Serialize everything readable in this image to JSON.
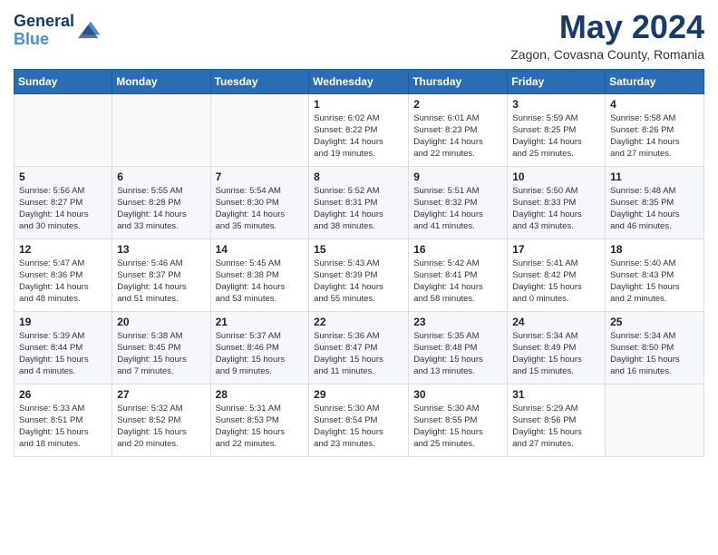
{
  "header": {
    "logo_line1": "General",
    "logo_line2": "Blue",
    "month": "May 2024",
    "location": "Zagon, Covasna County, Romania"
  },
  "weekdays": [
    "Sunday",
    "Monday",
    "Tuesday",
    "Wednesday",
    "Thursday",
    "Friday",
    "Saturday"
  ],
  "weeks": [
    [
      {
        "day": "",
        "info": ""
      },
      {
        "day": "",
        "info": ""
      },
      {
        "day": "",
        "info": ""
      },
      {
        "day": "1",
        "info": "Sunrise: 6:02 AM\nSunset: 8:22 PM\nDaylight: 14 hours\nand 19 minutes."
      },
      {
        "day": "2",
        "info": "Sunrise: 6:01 AM\nSunset: 8:23 PM\nDaylight: 14 hours\nand 22 minutes."
      },
      {
        "day": "3",
        "info": "Sunrise: 5:59 AM\nSunset: 8:25 PM\nDaylight: 14 hours\nand 25 minutes."
      },
      {
        "day": "4",
        "info": "Sunrise: 5:58 AM\nSunset: 8:26 PM\nDaylight: 14 hours\nand 27 minutes."
      }
    ],
    [
      {
        "day": "5",
        "info": "Sunrise: 5:56 AM\nSunset: 8:27 PM\nDaylight: 14 hours\nand 30 minutes."
      },
      {
        "day": "6",
        "info": "Sunrise: 5:55 AM\nSunset: 8:28 PM\nDaylight: 14 hours\nand 33 minutes."
      },
      {
        "day": "7",
        "info": "Sunrise: 5:54 AM\nSunset: 8:30 PM\nDaylight: 14 hours\nand 35 minutes."
      },
      {
        "day": "8",
        "info": "Sunrise: 5:52 AM\nSunset: 8:31 PM\nDaylight: 14 hours\nand 38 minutes."
      },
      {
        "day": "9",
        "info": "Sunrise: 5:51 AM\nSunset: 8:32 PM\nDaylight: 14 hours\nand 41 minutes."
      },
      {
        "day": "10",
        "info": "Sunrise: 5:50 AM\nSunset: 8:33 PM\nDaylight: 14 hours\nand 43 minutes."
      },
      {
        "day": "11",
        "info": "Sunrise: 5:48 AM\nSunset: 8:35 PM\nDaylight: 14 hours\nand 46 minutes."
      }
    ],
    [
      {
        "day": "12",
        "info": "Sunrise: 5:47 AM\nSunset: 8:36 PM\nDaylight: 14 hours\nand 48 minutes."
      },
      {
        "day": "13",
        "info": "Sunrise: 5:46 AM\nSunset: 8:37 PM\nDaylight: 14 hours\nand 51 minutes."
      },
      {
        "day": "14",
        "info": "Sunrise: 5:45 AM\nSunset: 8:38 PM\nDaylight: 14 hours\nand 53 minutes."
      },
      {
        "day": "15",
        "info": "Sunrise: 5:43 AM\nSunset: 8:39 PM\nDaylight: 14 hours\nand 55 minutes."
      },
      {
        "day": "16",
        "info": "Sunrise: 5:42 AM\nSunset: 8:41 PM\nDaylight: 14 hours\nand 58 minutes."
      },
      {
        "day": "17",
        "info": "Sunrise: 5:41 AM\nSunset: 8:42 PM\nDaylight: 15 hours\nand 0 minutes."
      },
      {
        "day": "18",
        "info": "Sunrise: 5:40 AM\nSunset: 8:43 PM\nDaylight: 15 hours\nand 2 minutes."
      }
    ],
    [
      {
        "day": "19",
        "info": "Sunrise: 5:39 AM\nSunset: 8:44 PM\nDaylight: 15 hours\nand 4 minutes."
      },
      {
        "day": "20",
        "info": "Sunrise: 5:38 AM\nSunset: 8:45 PM\nDaylight: 15 hours\nand 7 minutes."
      },
      {
        "day": "21",
        "info": "Sunrise: 5:37 AM\nSunset: 8:46 PM\nDaylight: 15 hours\nand 9 minutes."
      },
      {
        "day": "22",
        "info": "Sunrise: 5:36 AM\nSunset: 8:47 PM\nDaylight: 15 hours\nand 11 minutes."
      },
      {
        "day": "23",
        "info": "Sunrise: 5:35 AM\nSunset: 8:48 PM\nDaylight: 15 hours\nand 13 minutes."
      },
      {
        "day": "24",
        "info": "Sunrise: 5:34 AM\nSunset: 8:49 PM\nDaylight: 15 hours\nand 15 minutes."
      },
      {
        "day": "25",
        "info": "Sunrise: 5:34 AM\nSunset: 8:50 PM\nDaylight: 15 hours\nand 16 minutes."
      }
    ],
    [
      {
        "day": "26",
        "info": "Sunrise: 5:33 AM\nSunset: 8:51 PM\nDaylight: 15 hours\nand 18 minutes."
      },
      {
        "day": "27",
        "info": "Sunrise: 5:32 AM\nSunset: 8:52 PM\nDaylight: 15 hours\nand 20 minutes."
      },
      {
        "day": "28",
        "info": "Sunrise: 5:31 AM\nSunset: 8:53 PM\nDaylight: 15 hours\nand 22 minutes."
      },
      {
        "day": "29",
        "info": "Sunrise: 5:30 AM\nSunset: 8:54 PM\nDaylight: 15 hours\nand 23 minutes."
      },
      {
        "day": "30",
        "info": "Sunrise: 5:30 AM\nSunset: 8:55 PM\nDaylight: 15 hours\nand 25 minutes."
      },
      {
        "day": "31",
        "info": "Sunrise: 5:29 AM\nSunset: 8:56 PM\nDaylight: 15 hours\nand 27 minutes."
      },
      {
        "day": "",
        "info": ""
      }
    ]
  ]
}
